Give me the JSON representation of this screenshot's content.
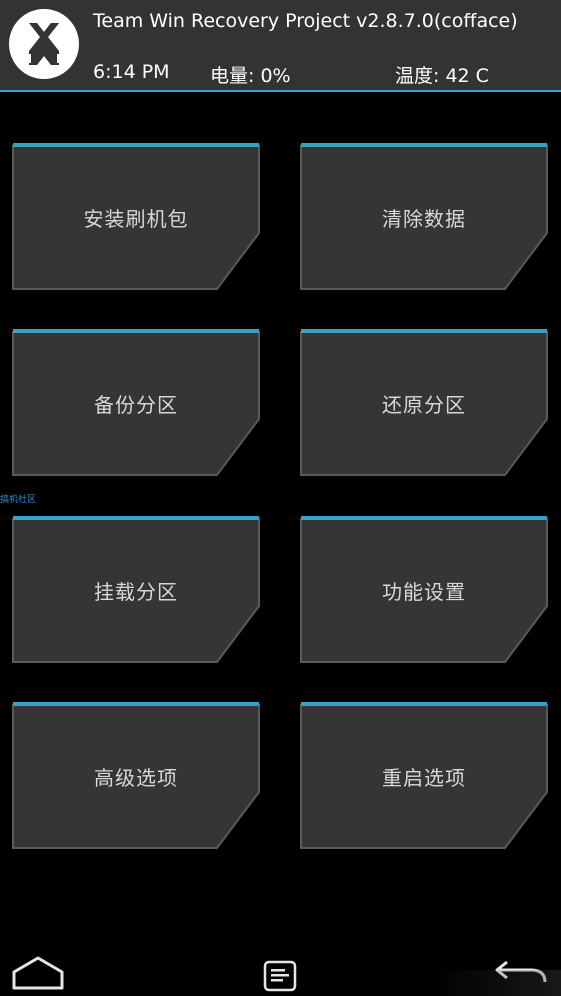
{
  "header": {
    "title": "Team Win Recovery Project  v2.8.7.0(cofface)",
    "time": "6:14 PM",
    "battery": "电量: 0%",
    "temperature": "温度: 42 C"
  },
  "watermark": "搞机社区",
  "menu": {
    "install": "安装刷机包",
    "wipe": "清除数据",
    "backup": "备份分区",
    "restore": "还原分区",
    "mount": "挂载分区",
    "settings": "功能设置",
    "advanced": "高级选项",
    "reboot": "重启选项"
  },
  "colors": {
    "accent": "#35a2c6",
    "header_bg": "#333333",
    "tile_bg": "#353535",
    "tile_border": "#555555",
    "text": "#d8d8d8"
  },
  "icons": {
    "logo": "twrp-logo-icon",
    "home": "home-icon",
    "log": "console-icon",
    "back": "back-arrow-icon"
  }
}
